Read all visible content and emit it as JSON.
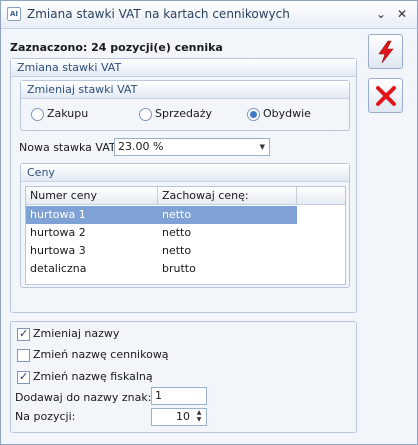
{
  "window": {
    "title": "Zmiana stawki VAT na kartach cennikowych",
    "icon_text": "AI"
  },
  "selection": {
    "text": "Zaznaczono: 24 pozycji(e) cennika"
  },
  "vat_panel": {
    "title": "Zmiana stawki VAT",
    "mode_group": {
      "title": "Zmieniaj stawki VAT",
      "options": [
        {
          "label": "Zakupu",
          "selected": false
        },
        {
          "label": "Sprzedaży",
          "selected": false
        },
        {
          "label": "Obydwie",
          "selected": true
        }
      ]
    },
    "new_rate": {
      "label": "Nowa stawka VAT:",
      "value": "23.00 %"
    },
    "prices": {
      "title": "Ceny",
      "columns": [
        "Numer ceny",
        "Zachowaj cenę:"
      ],
      "rows": [
        {
          "name": "hurtowa 1",
          "keep": "netto",
          "selected": true
        },
        {
          "name": "hurtowa 2",
          "keep": "netto",
          "selected": false
        },
        {
          "name": "hurtowa 3",
          "keep": "netto",
          "selected": false
        },
        {
          "name": "detaliczna",
          "keep": "brutto",
          "selected": false
        }
      ]
    }
  },
  "names_panel": {
    "checkboxes": [
      {
        "label": "Zmieniaj nazwy",
        "checked": true
      },
      {
        "label": "Zmień nazwę cennikową",
        "checked": false
      },
      {
        "label": "Zmień nazwę fiskalną",
        "checked": true
      }
    ],
    "add_chars": {
      "label": "Dodawaj do nazwy znak:",
      "value": "1"
    },
    "position": {
      "label": "Na pozycji:",
      "value": "10"
    }
  },
  "icons": {
    "run": "lightning-icon",
    "cancel": "close-x-icon",
    "accent_red": "#e0161b",
    "selection_color": "#7fa2d6"
  },
  "titlebar_buttons": {
    "minimize": "⌄",
    "close": "✕"
  }
}
